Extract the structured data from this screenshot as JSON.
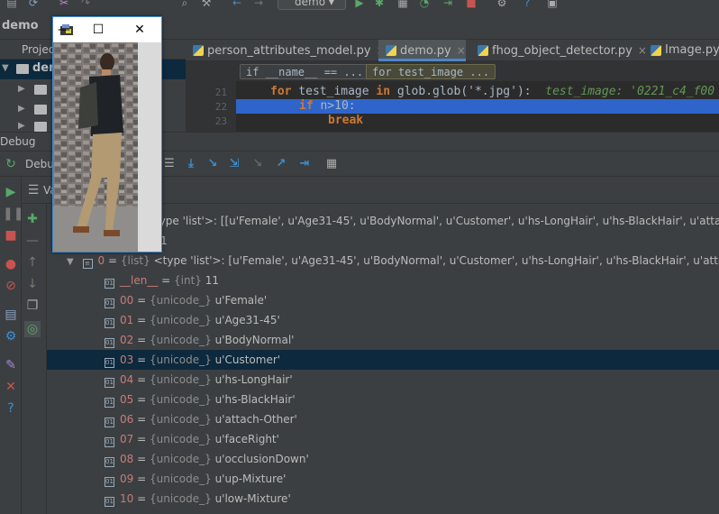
{
  "toolbar": {
    "run_config": "demo"
  },
  "breadcrumb": {
    "project": "demo"
  },
  "project_panel": {
    "label": "Project",
    "root": "dem"
  },
  "editor": {
    "tabs": [
      {
        "label": "person_attributes_model.py",
        "active": false
      },
      {
        "label": "demo.py",
        "active": true
      },
      {
        "label": "fhog_object_detector.py",
        "active": false
      },
      {
        "label": "Image.py",
        "active": false
      }
    ],
    "crumbs": [
      "if __name__ == ...",
      "for test_image ..."
    ],
    "lines": [
      {
        "num": "21",
        "keyword": "for",
        "text": " test_image ",
        "keyword2": "in",
        "text2": " glob.glob('*.jpg'):  ",
        "comment": "test_image: '0221_c4_f00"
      },
      {
        "num": "22",
        "keyword": "if",
        "text": " n>10:"
      },
      {
        "num": "23",
        "keyword": "break"
      }
    ]
  },
  "debug": {
    "title": "Debug",
    "tab": "Debu",
    "vars_title": "Va"
  },
  "variables": {
    "root_fragment": "type 'list'>: [[u'Female', u'Age31-45', u'BodyNormal', u'Customer', u'hs-LongHair', u'hs-BlackHair', u'attach-O",
    "len_fragment": "1",
    "rows": [
      {
        "name": "0",
        "type": "{list}",
        "value": "<type 'list'>: [u'Female', u'Age31-45', u'BodyNormal', u'Customer', u'hs-LongHair', u'hs-BlackHair', u'attach-Oth"
      },
      {
        "name": "__len__",
        "type": "{int}",
        "value": "11"
      },
      {
        "name": "00",
        "type": "{unicode_}",
        "value": "u'Female'"
      },
      {
        "name": "01",
        "type": "{unicode_}",
        "value": "u'Age31-45'"
      },
      {
        "name": "02",
        "type": "{unicode_}",
        "value": "u'BodyNormal'"
      },
      {
        "name": "03",
        "type": "{unicode_}",
        "value": "u'Customer'",
        "selected": true
      },
      {
        "name": "04",
        "type": "{unicode_}",
        "value": "u'hs-LongHair'"
      },
      {
        "name": "05",
        "type": "{unicode_}",
        "value": "u'hs-BlackHair'"
      },
      {
        "name": "06",
        "type": "{unicode_}",
        "value": "u'attach-Other'"
      },
      {
        "name": "07",
        "type": "{unicode_}",
        "value": "u'faceRight'"
      },
      {
        "name": "08",
        "type": "{unicode_}",
        "value": "u'occlusionDown'"
      },
      {
        "name": "09",
        "type": "{unicode_}",
        "value": "u'up-Mixture'"
      },
      {
        "name": "10",
        "type": "{unicode_}",
        "value": "u'low-Mixture'"
      }
    ]
  },
  "image_window": {
    "minimize": "—",
    "maximize": "☐",
    "close": "✕"
  },
  "colors": {
    "accent": "#4a88c7",
    "selection": "#0d293e",
    "execution_line": "#2f65ca"
  }
}
